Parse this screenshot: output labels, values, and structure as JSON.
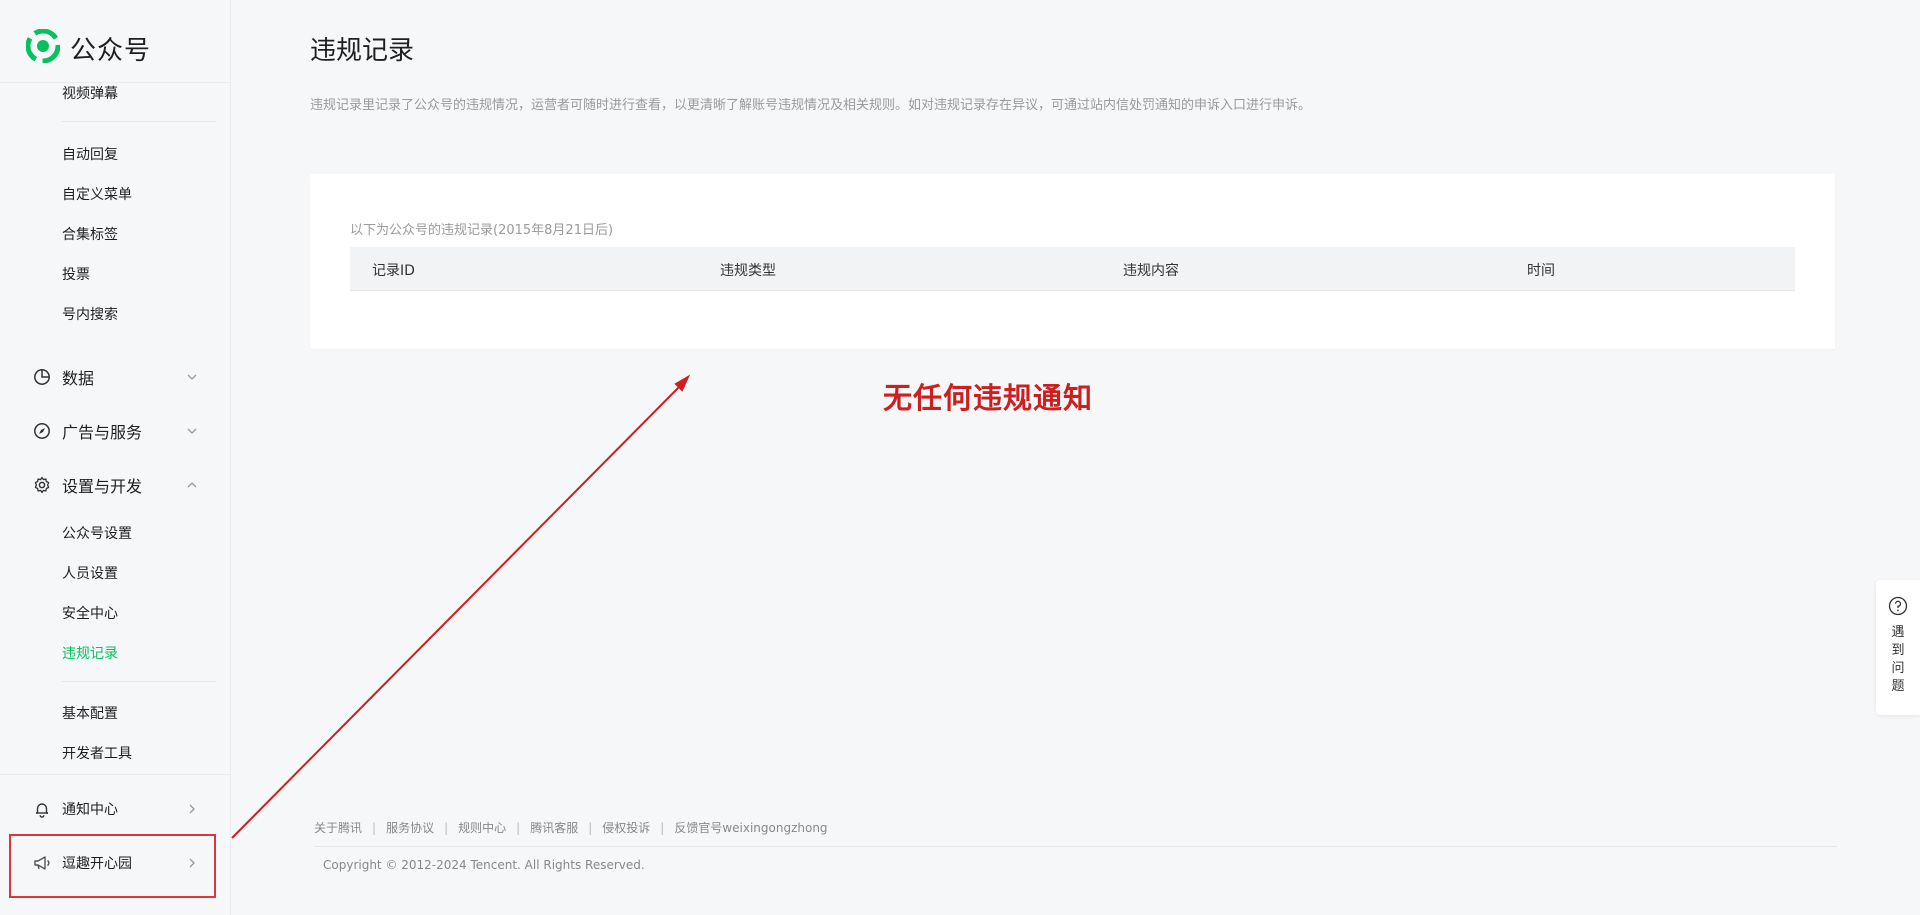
{
  "brand": {
    "name": "公众号",
    "color": "#07c160"
  },
  "sidebar": {
    "top_items": [
      "视频弹幕",
      "自动回复",
      "自定义菜单",
      "合集标签",
      "投票",
      "号内搜索"
    ],
    "groups": {
      "data": {
        "label": "数据",
        "icon": "pie-chart-icon",
        "expanded": false
      },
      "ads": {
        "label": "广告与服务",
        "icon": "compass-icon",
        "expanded": false
      },
      "settings": {
        "label": "设置与开发",
        "icon": "gear-icon",
        "expanded": true
      }
    },
    "settings_items": [
      "公众号设置",
      "人员设置",
      "安全中心",
      "违规记录"
    ],
    "settings_items_2": [
      "基本配置",
      "开发者工具"
    ],
    "active_item": "违规记录",
    "notify": {
      "label": "通知中心",
      "icon": "bell-icon"
    },
    "fun": {
      "label": "逗趣开心园",
      "icon": "megaphone-icon"
    }
  },
  "main": {
    "title": "违规记录",
    "description": "违规记录里记录了公众号的违规情况，运营者可随时进行查看，以更清晰了解账号违规情况及相关规则。如对违规记录存在异议，可通过站内信处罚通知的申诉入口进行申诉。",
    "card_caption": "以下为公众号的违规记录(2015年8月21日后)",
    "table_headers": [
      "记录ID",
      "违规类型",
      "违规内容",
      "时间"
    ]
  },
  "annotation": {
    "text": "无任何违规通知",
    "color": "#cc1f1f"
  },
  "footer": {
    "links": [
      "关于腾讯",
      "服务协议",
      "规则中心",
      "腾讯客服",
      "侵权投诉",
      "反馈官号weixingongzhong"
    ],
    "copyright": "Copyright © 2012-2024 Tencent. All Rights Reserved."
  },
  "help": {
    "label": "遇到问题",
    "chars": [
      "遇",
      "到",
      "问",
      "题"
    ],
    "icon": "question-circle-icon"
  }
}
